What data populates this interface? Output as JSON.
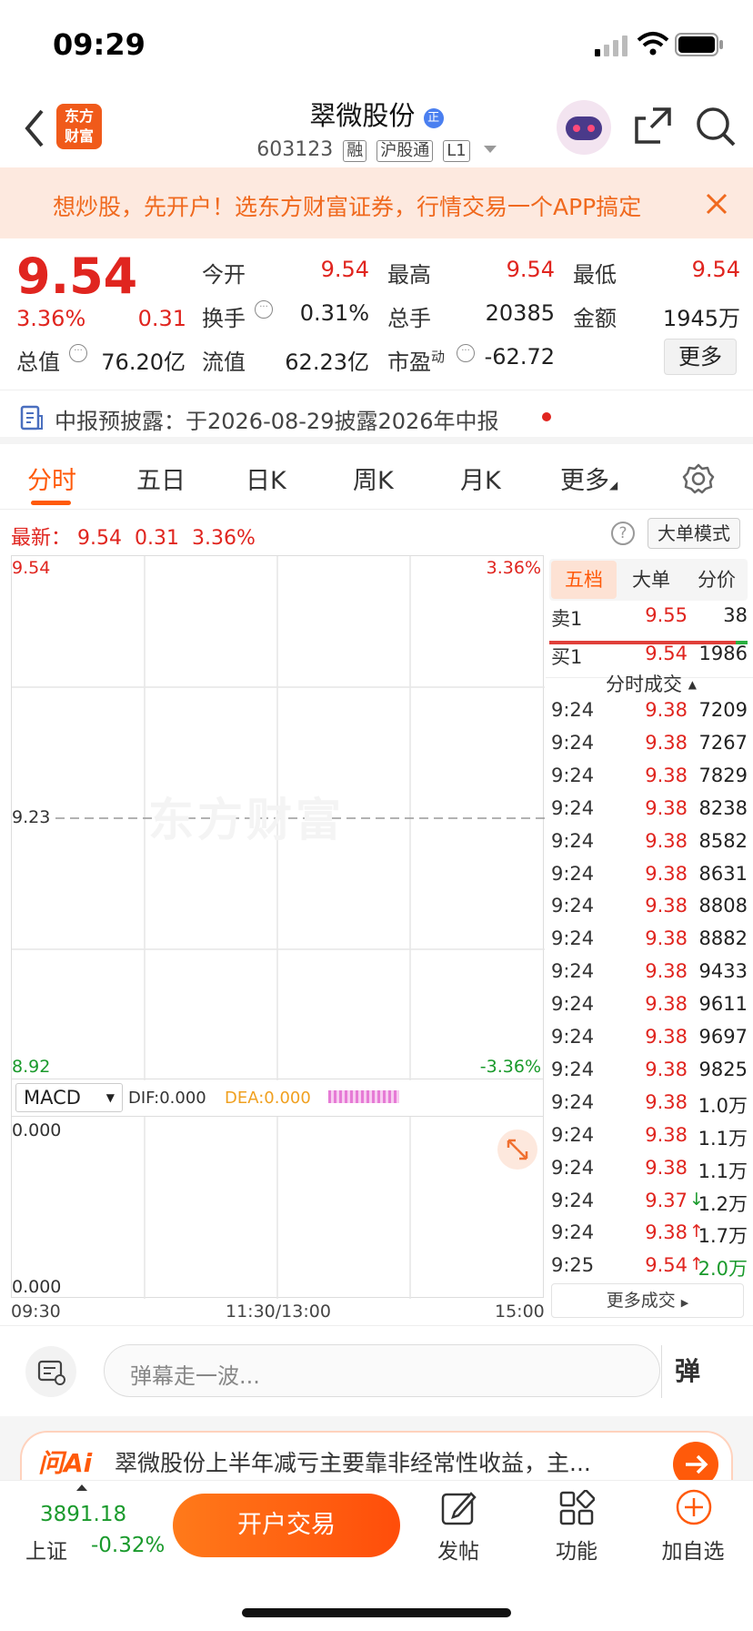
{
  "status": {
    "time": "09:29"
  },
  "header": {
    "logo_line1": "东方",
    "logo_line2": "财富",
    "stock_name": "翠微股份",
    "stock_badge": "正",
    "stock_code": "603123",
    "tags": [
      "融",
      "沪股通",
      "L1"
    ]
  },
  "banner": {
    "text": "想炒股，先开户！选东方财富证券，行情交易一个APP搞定"
  },
  "quote": {
    "price": "9.54",
    "change_pct": "3.36%",
    "change_amt": "0.31",
    "open_label": "今开",
    "open": "9.54",
    "high_label": "最高",
    "high": "9.54",
    "low_label": "最低",
    "low": "9.54",
    "turnover_label": "换手",
    "turnover": "0.31%",
    "volume_label": "总手",
    "volume": "20385",
    "amount_label": "金额",
    "amount": "1945万",
    "mktcap_label": "总值",
    "mktcap": "76.20亿",
    "float_label": "流值",
    "float": "62.23亿",
    "pe_label": "市盈",
    "pe_sup": "动",
    "pe": "-62.72",
    "more_button": "更多"
  },
  "announce": {
    "text": "中报预披露：于2026-08-29披露2026年中报"
  },
  "tabs": [
    "分时",
    "五日",
    "日K",
    "周K",
    "月K",
    "更多"
  ],
  "latest": {
    "label": "最新：",
    "price": "9.54",
    "amt": "0.31",
    "pct": "3.36%",
    "big_order_mode": "大单模式"
  },
  "chart": {
    "y_top": "9.54",
    "y_mid": "9.23",
    "y_bottom": "8.92",
    "pct_top": "3.36%",
    "pct_bottom": "-3.36%",
    "watermark": "东方财富",
    "macd_select": "MACD",
    "dif": "DIF:0.000",
    "dea": "DEA:0.000",
    "macd_top": "0.000",
    "macd_bottom": "0.000",
    "time_start": "09:30",
    "time_mid": "11:30/13:00",
    "time_end": "15:00"
  },
  "panel": {
    "tabs": [
      "五档",
      "大单",
      "分价"
    ],
    "sell1_label": "卖1",
    "sell1_price": "9.55",
    "sell1_vol": "38",
    "buy1_label": "买1",
    "buy1_price": "9.54",
    "buy1_vol": "1986",
    "trades_title": "分时成交",
    "more_trades": "更多成交",
    "trades": [
      {
        "t": "9:24",
        "p": "9.38",
        "v": "7209",
        "arrow": ""
      },
      {
        "t": "9:24",
        "p": "9.38",
        "v": "7267",
        "arrow": ""
      },
      {
        "t": "9:24",
        "p": "9.38",
        "v": "7829",
        "arrow": ""
      },
      {
        "t": "9:24",
        "p": "9.38",
        "v": "8238",
        "arrow": ""
      },
      {
        "t": "9:24",
        "p": "9.38",
        "v": "8582",
        "arrow": ""
      },
      {
        "t": "9:24",
        "p": "9.38",
        "v": "8631",
        "arrow": ""
      },
      {
        "t": "9:24",
        "p": "9.38",
        "v": "8808",
        "arrow": ""
      },
      {
        "t": "9:24",
        "p": "9.38",
        "v": "8882",
        "arrow": ""
      },
      {
        "t": "9:24",
        "p": "9.38",
        "v": "9433",
        "arrow": ""
      },
      {
        "t": "9:24",
        "p": "9.38",
        "v": "9611",
        "arrow": ""
      },
      {
        "t": "9:24",
        "p": "9.38",
        "v": "9697",
        "arrow": ""
      },
      {
        "t": "9:24",
        "p": "9.38",
        "v": "9825",
        "arrow": ""
      },
      {
        "t": "9:24",
        "p": "9.38",
        "v": "1.0万",
        "arrow": ""
      },
      {
        "t": "9:24",
        "p": "9.38",
        "v": "1.1万",
        "arrow": ""
      },
      {
        "t": "9:24",
        "p": "9.38",
        "v": "1.1万",
        "arrow": ""
      },
      {
        "t": "9:24",
        "p": "9.37",
        "v": "1.2万",
        "arrow": "↓"
      },
      {
        "t": "9:24",
        "p": "9.38",
        "v": "1.7万",
        "arrow": "↑"
      },
      {
        "t": "9:25",
        "p": "9.54",
        "v": "2.0万",
        "arrow": "↑",
        "vcolor": "green"
      }
    ]
  },
  "danmaku": {
    "placeholder": "弹幕走一波...",
    "button": "弹"
  },
  "ai": {
    "logo": "问Ai",
    "text": "翠微股份上半年减亏主要靠非经常性收益，主..."
  },
  "bottom": {
    "index_value": "3891.18",
    "index_name": "上证",
    "index_change": "-0.32%",
    "open_account": "开户交易",
    "post": "发帖",
    "functions": "功能",
    "add_watch": "加自选"
  }
}
